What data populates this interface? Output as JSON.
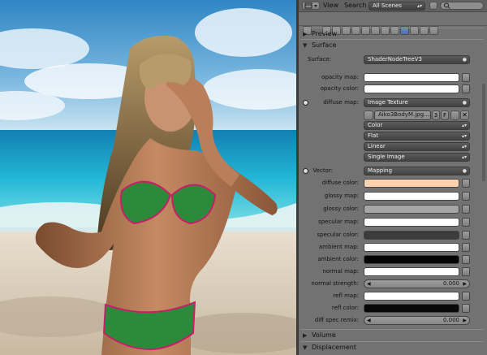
{
  "header": {
    "menu": [
      "View",
      "Search"
    ],
    "scene_select": "All Scenes"
  },
  "sections": {
    "preview": "Preview",
    "surface": "Surface",
    "volume": "Volume",
    "displacement": "Displacement"
  },
  "surface": {
    "label": "Surface:",
    "shader": "ShaderNodeTreeV3"
  },
  "rows": {
    "opacity_map": "opacity map:",
    "opacity_color": "opacity color:",
    "diffuse_map": "diffuse map:",
    "diffuse_map_value": "Image Texture",
    "image_name": "Aiko3BodyM.jpg....",
    "image_users": "3",
    "image_fake": "F",
    "color_space": "Color",
    "projection": "Flat",
    "interpolation": "Linear",
    "source": "Single Image",
    "vector": "Vector:",
    "vector_value": "Mapping",
    "diffuse_color": "diffuse color:",
    "glossy_map": "glossy map:",
    "glossy_color": "glossy color:",
    "specular_map": "specular map:",
    "specular_color": "specular color:",
    "ambient_map": "ambient map:",
    "ambient_color": "ambient color:",
    "normal_map": "normal map:",
    "normal_strength": "normal strength:",
    "normal_strength_value": "0.000",
    "refl_map": "refl map:",
    "refl_color": "refl color:",
    "diff_spec_remix": "diff spec remix:",
    "diff_spec_remix_value": "0.000"
  },
  "colors": {
    "diffuse_color": "#ffd1ad",
    "glossy_color": "#a6a6a6",
    "specular_color": "#3c3c3c",
    "ambient_color": "#050505",
    "refl_color": "#080808",
    "white": "#ffffff"
  },
  "icons": [
    "editor-type-icon",
    "search-icon",
    "render-icon",
    "render-layers-icon",
    "scene-icon",
    "world-icon",
    "object-icon",
    "constraints-icon",
    "modifiers-icon",
    "data-icon",
    "material-icon",
    "texture-icon",
    "particles-icon",
    "physics-icon"
  ]
}
